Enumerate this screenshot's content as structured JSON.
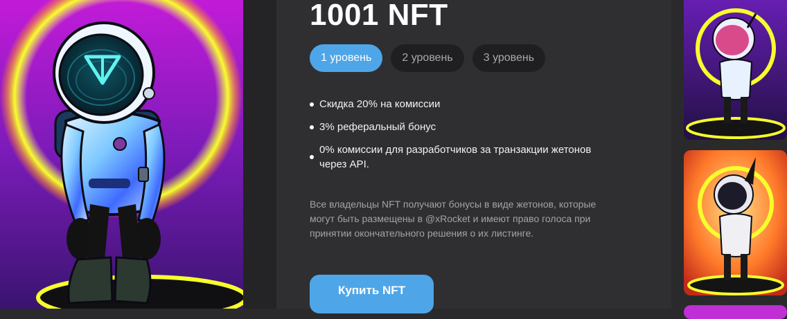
{
  "nft": {
    "title": "1001 NFT"
  },
  "tabs": [
    {
      "label": "1 уровень",
      "active": true
    },
    {
      "label": "2 уровень",
      "active": false
    },
    {
      "label": "3 уровень",
      "active": false
    }
  ],
  "benefits": [
    "Скидка 20% на комиссии",
    "3% реферальный бонус",
    "0% комиссии для разработчиков за транзакции жетонов через API."
  ],
  "note": "Все владельцы NFT получают бонусы в виде жетонов, которые могут быть размещены в @xRocket и имеют право голоса при принятии окончательного решения о их листинге.",
  "buy_button": {
    "label": "Купить NFT"
  },
  "colors": {
    "accent": "#4ea6e8",
    "panel": "#2f2f31",
    "page": "#2a2a2c",
    "tab_inactive": "#1f1f21",
    "muted_text": "#a3a3a8",
    "neon_ring": "#f3ff2a"
  },
  "icons": {
    "hero_image": "astronaut-nft-artwork",
    "helmet_logo": "ton-triangle-logo"
  }
}
